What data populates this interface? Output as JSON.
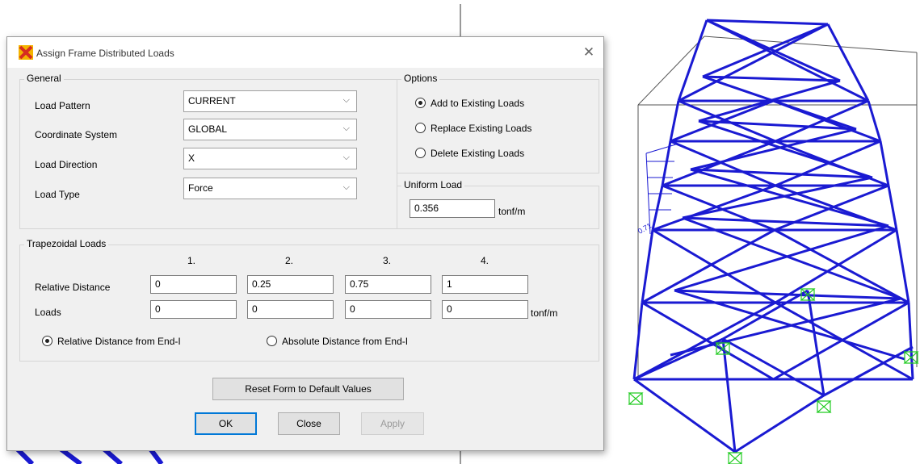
{
  "dialog": {
    "title": "Assign Frame Distributed Loads",
    "close_glyph": "✕"
  },
  "general": {
    "label": "General",
    "fields": [
      {
        "label": "Load Pattern",
        "value": "CURRENT"
      },
      {
        "label": "Coordinate System",
        "value": "GLOBAL"
      },
      {
        "label": "Load Direction",
        "value": "X"
      },
      {
        "label": "Load Type",
        "value": "Force"
      }
    ]
  },
  "options": {
    "label": "Options",
    "items": [
      {
        "label": "Add to Existing Loads",
        "selected": true
      },
      {
        "label": "Replace Existing Loads",
        "selected": false
      },
      {
        "label": "Delete Existing Loads",
        "selected": false
      }
    ]
  },
  "uniform": {
    "label": "Uniform Load",
    "value": "0.356",
    "unit": "tonf/m"
  },
  "trapezoidal": {
    "label": "Trapezoidal Loads",
    "columns": [
      "1.",
      "2.",
      "3.",
      "4."
    ],
    "relative_distance_label": "Relative Distance",
    "relative_distance": [
      "0",
      "0.25",
      "0.75",
      "1"
    ],
    "loads_label": "Loads",
    "loads": [
      "0",
      "0",
      "0",
      "0"
    ],
    "unit": "tonf/m",
    "distance_options": [
      {
        "label": "Relative Distance from End-I",
        "selected": true
      },
      {
        "label": "Absolute Distance from End-I",
        "selected": false
      }
    ]
  },
  "buttons": {
    "reset": "Reset Form to Default Values",
    "ok": "OK",
    "close": "Close",
    "apply": "Apply"
  },
  "colors": {
    "frame": "#1a1ad2",
    "support": "#22cc22",
    "accent": "#0078d7"
  },
  "background": {
    "load_label": "0.71"
  }
}
